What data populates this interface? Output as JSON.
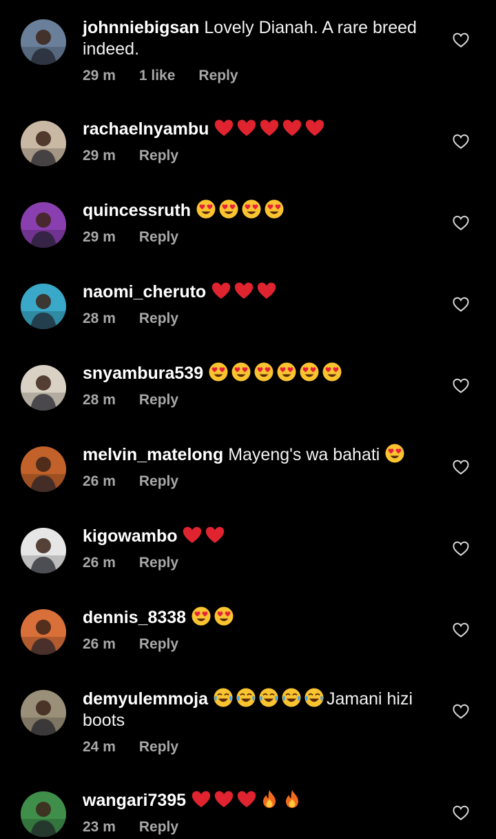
{
  "colors": {
    "background": "#000000",
    "username": "#ffffff",
    "text": "#f2f2f2",
    "meta": "#a8a8a8",
    "heart": "#e0242f",
    "emoji_face": "#f9c430"
  },
  "comments": [
    {
      "username": "johnniebigsan",
      "text": "Lovely Dianah. A rare breed indeed.",
      "time": "29 m",
      "likes": "1 like",
      "reply": "Reply",
      "avatar_hue": "#6a7f9a",
      "emojis": []
    },
    {
      "username": "rachaelnyambu",
      "text": "",
      "time": "29 m",
      "reply": "Reply",
      "avatar_hue": "#c9b8a3",
      "emojis": [
        "heart-emoji",
        "heart-emoji",
        "heart-emoji",
        "heart-emoji",
        "heart-emoji"
      ]
    },
    {
      "username": "quincessruth",
      "text": "",
      "time": "29 m",
      "reply": "Reply",
      "avatar_hue": "#8a3fb0",
      "emojis": [
        "heart-eyes-emoji",
        "heart-eyes-emoji",
        "heart-eyes-emoji",
        "heart-eyes-emoji"
      ]
    },
    {
      "username": "naomi_cheruto",
      "text": "",
      "time": "28 m",
      "reply": "Reply",
      "avatar_hue": "#3aa9c9",
      "emojis": [
        "heart-emoji",
        "heart-emoji",
        "heart-emoji"
      ]
    },
    {
      "username": "snyambura539",
      "text": "",
      "time": "28 m",
      "reply": "Reply",
      "avatar_hue": "#d9d2c4",
      "emojis": [
        "heart-eyes-emoji",
        "heart-eyes-emoji",
        "heart-eyes-emoji",
        "heart-eyes-emoji",
        "heart-eyes-emoji",
        "heart-eyes-emoji"
      ]
    },
    {
      "username": "melvin_matelong",
      "text": "Mayeng's wa bahati",
      "time": "26 m",
      "reply": "Reply",
      "avatar_hue": "#c2622a",
      "emojis": [
        "heart-eyes-emoji"
      ]
    },
    {
      "username": "kigowambo",
      "text": "",
      "time": "26 m",
      "reply": "Reply",
      "avatar_hue": "#e6e6e6",
      "emojis": [
        "heart-emoji",
        "heart-emoji"
      ]
    },
    {
      "username": "dennis_8338",
      "text": "",
      "time": "26 m",
      "reply": "Reply",
      "avatar_hue": "#d9703a",
      "emojis": [
        "heart-eyes-emoji",
        "heart-eyes-emoji"
      ]
    },
    {
      "username": "demyulemmoja",
      "text": "Jamani hizi boots",
      "time": "24 m",
      "reply": "Reply",
      "avatar_hue": "#9a8f78",
      "emojis": [
        "tears-of-joy-emoji",
        "tears-of-joy-emoji",
        "tears-of-joy-emoji",
        "tears-of-joy-emoji",
        "tears-of-joy-emoji"
      ]
    },
    {
      "username": "wangari7395",
      "text": "",
      "time": "23 m",
      "reply": "Reply",
      "avatar_hue": "#3f8f4a",
      "emojis": [
        "heart-emoji",
        "heart-emoji",
        "heart-emoji",
        "fire-emoji",
        "fire-emoji"
      ]
    }
  ]
}
